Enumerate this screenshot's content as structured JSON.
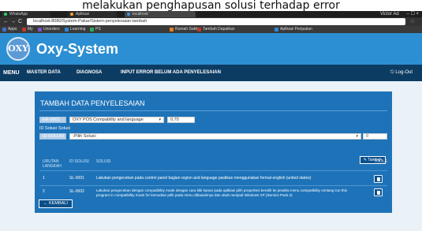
{
  "caption": "melakukan penghapusan solusi terhadap error",
  "browser": {
    "tabs": [
      {
        "label": "WhatsApp",
        "color": "#25d366"
      },
      {
        "label": "Aplikasi",
        "color": "#f2a33a"
      },
      {
        "label": "localhost",
        "color": "#4a90e2"
      }
    ],
    "tab_close": "×",
    "window_user": "Victor Ad",
    "window_controls": "–   ☐   ×",
    "back": "←",
    "forward": "→",
    "reload": "C",
    "url": "localhost:8080/System-Pakar/Sistem-penyelesaian-tambah",
    "star": "☆",
    "bookmarks": [
      {
        "label": "Apps",
        "color": "#3d6fcf"
      },
      {
        "label": "My",
        "color": "#c0392b"
      },
      {
        "label": "Unorders",
        "color": "#7b54c6"
      },
      {
        "label": "Learning",
        "color": "#2e86de"
      },
      {
        "label": "PS",
        "color": "#27ae60"
      },
      {
        "label": "Rumah Sakit",
        "color": "#e67e22"
      },
      {
        "label": "Tambah Dapatkan",
        "color": "#c0392b"
      },
      {
        "label": "Aplikasi Penjualan",
        "color": "#2e86de"
      }
    ]
  },
  "app": {
    "logo": "OXY",
    "brand": "Oxy-System"
  },
  "nav": {
    "menu": "MENU",
    "items": [
      "MASTER DATA",
      "DIAGNOSA",
      "INPUT ERROR BELUM ADA PENYELESAIAN"
    ],
    "logout": "⎋ Log-Out"
  },
  "form": {
    "title": "TAMBAH DATA PENYELESAIAN",
    "error_code": "ER-0001",
    "error_select": "OXY POS Compability and language",
    "error_value": "0.70",
    "caret": "▾",
    "label_id": "ID Solusi",
    "label_solusi": "Solusi",
    "id_placeholder": "ID SOLUSI",
    "solusi_select": "-Pilih Solusi-",
    "value_placeholder": "0",
    "add_button": "✎ Tambah",
    "back_button": "← KEMBALI"
  },
  "table": {
    "headers": {
      "urutan": "URUTAN LANGKAH",
      "id": "ID SOLUSI",
      "solusi": "SOLUSI",
      "tools": "TOOLS"
    },
    "rows": [
      {
        "no": "1",
        "id": "SL-0001",
        "text": "Lakukan pengecekan pada control panel bagian region and language pastikan menggunakan format english (united states)"
      },
      {
        "no": "2",
        "id": "SL-0002",
        "text": "Lakukan pengecekan dengan compatibility mode dengan cara klik kanan pada aplikasi pilih properties beralih ke jendela menu compatibility centang run this program in compatibility mode for kemudian pilih pada menu dibawahnya dan ubah menjadi Windows XP (Service Pack 2)"
      }
    ]
  }
}
